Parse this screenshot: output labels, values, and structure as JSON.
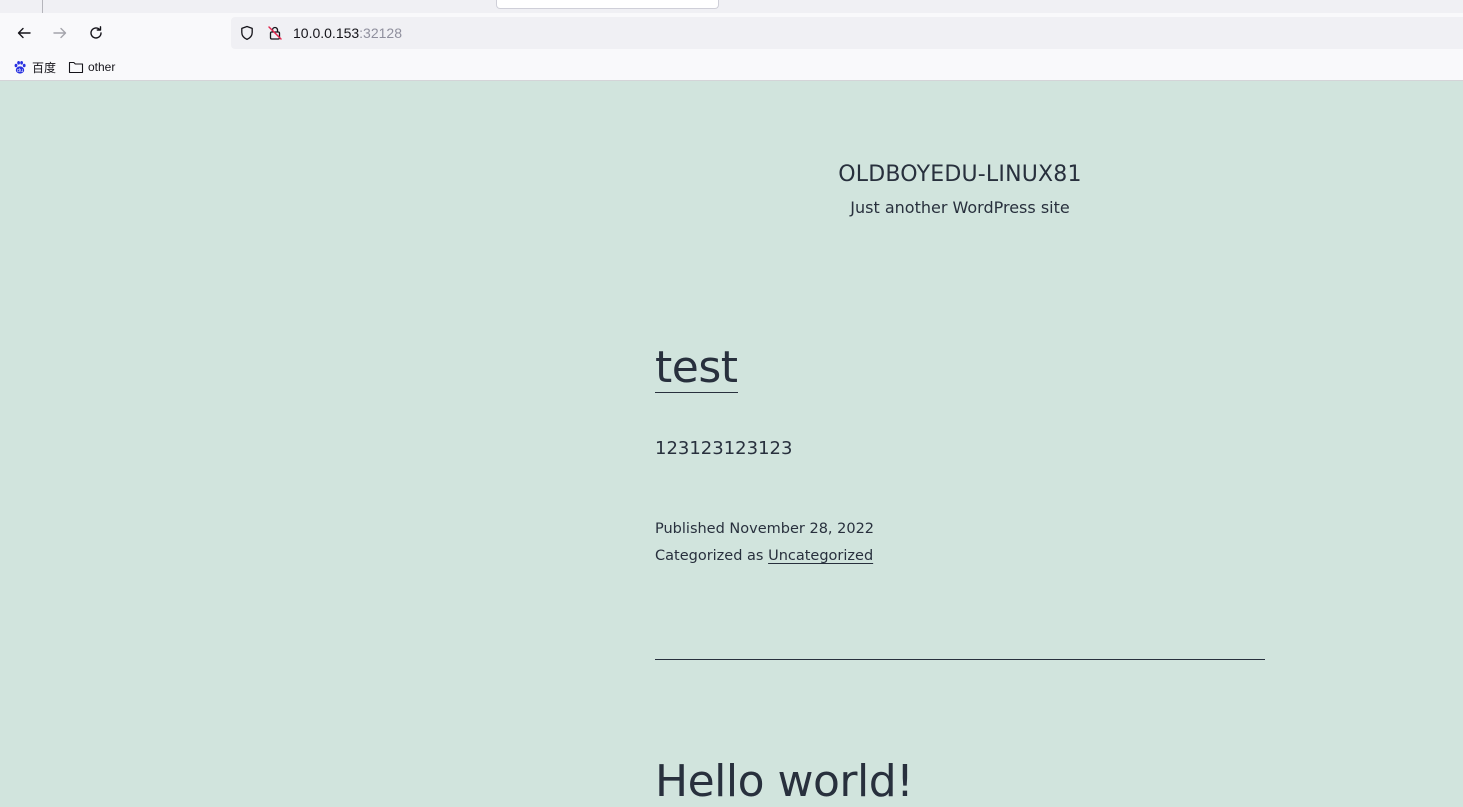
{
  "browser": {
    "url_host": "10.0.0.153",
    "url_port": ":32128",
    "bookmarks": [
      {
        "label": "百度",
        "icon": "baidu-paw-icon"
      },
      {
        "label": "other",
        "icon": "folder-icon"
      }
    ]
  },
  "site": {
    "title": "OLDBOYEDU-LINUX81",
    "description": "Just another WordPress site"
  },
  "posts": [
    {
      "title": "test",
      "content": "123123123123",
      "published_label": "Published",
      "published_date": "November 28, 2022",
      "category_label": "Categorized as",
      "category": "Uncategorized"
    },
    {
      "title": "Hello world!"
    }
  ],
  "colors": {
    "page_background": "#d1e4dd",
    "text": "#28303d",
    "chrome_background": "#f9f9fb",
    "urlbar_background": "#f0f0f4"
  }
}
